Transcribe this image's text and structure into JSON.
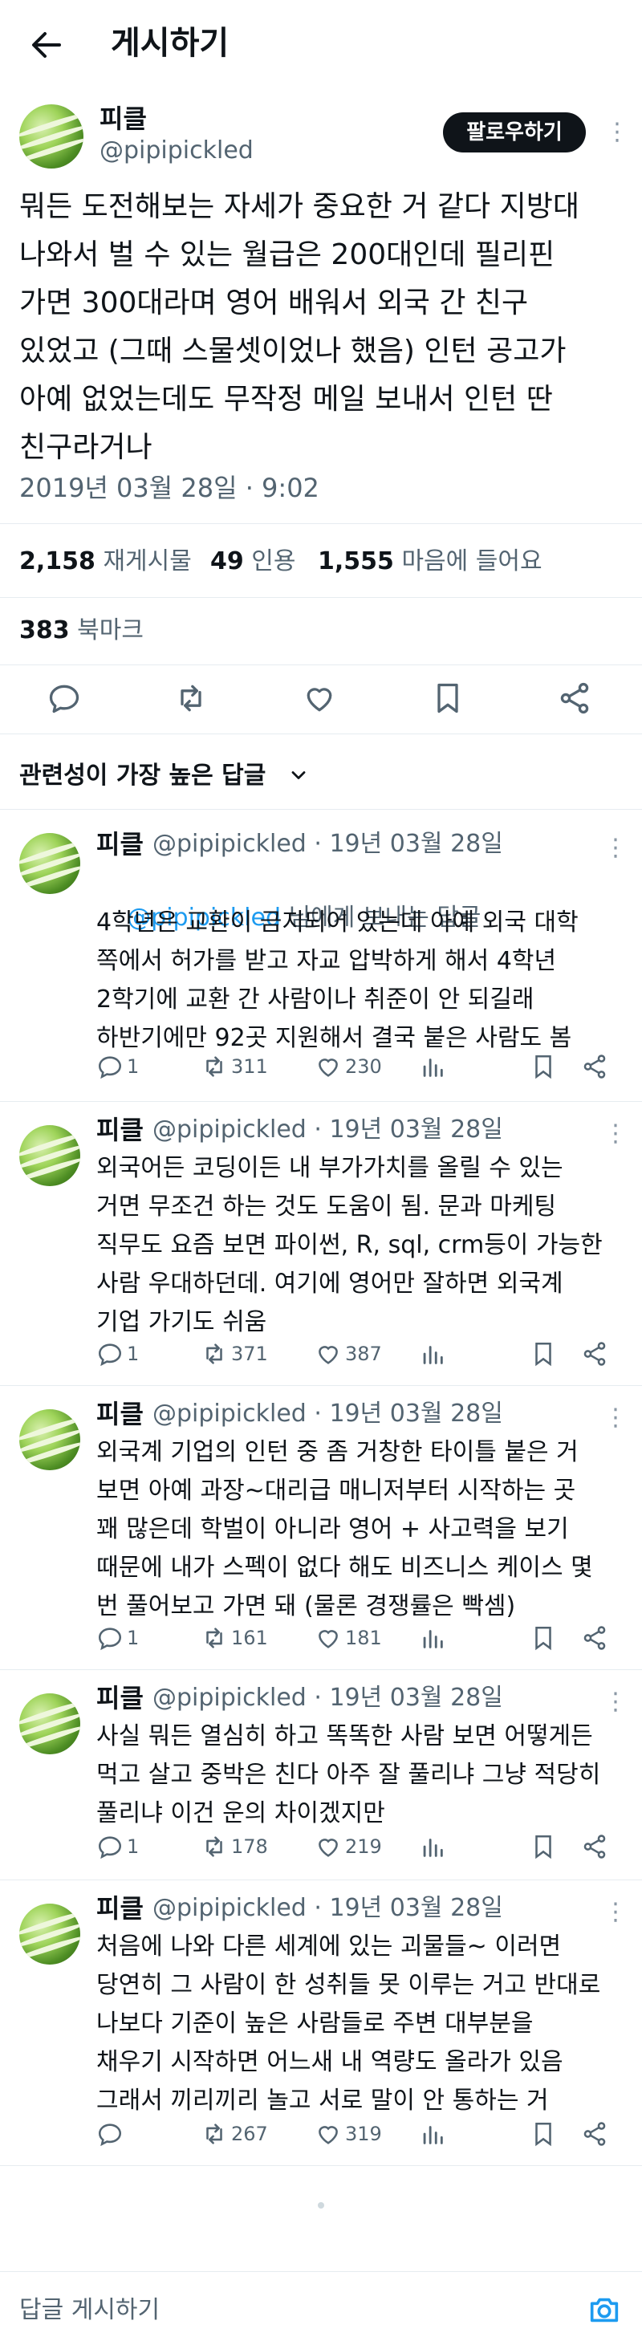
{
  "header": {
    "title": "게시하기"
  },
  "post": {
    "author_name": "피클",
    "author_handle": "@pipipickled",
    "follow_label": "팔로우하기",
    "more_label": "⋮",
    "text": "뭐든 도전해보는 자세가 중요한 거 같다 지방대\n나와서 벌 수 있는 월급은 200대인데 필리핀\n가면 300대라며 영어 배워서 외국 간 친구\n있었고 (그때 스물셋이었나 했음) 인턴 공고가\n아예 없었는데도 무작정 메일 보내서 인턴 딴\n친구라거나",
    "timestamp": "2019년 03월 28일 · 9:02",
    "stats": {
      "reposts_count": "2,158",
      "reposts_label": "재게시물",
      "quotes_count": "49",
      "quotes_label": "인용",
      "likes_count": "1,555",
      "likes_label": "마음에 들어요",
      "bookmarks_count": "383",
      "bookmarks_label": "북마크"
    }
  },
  "sort_label": "관련성이 가장 높은 답글",
  "replies": [
    {
      "name": "피클",
      "handle_line": "@pipipickled · 19년 03월 28일",
      "replying_to_mention": "@pipipickled",
      "replying_to_suffix": " 님에게 보내는 답글",
      "text": "4학년은 교환이 금지되어 있는데 아예 외국 대학\n쪽에서 허가를 받고 자교 압박하게 해서 4학년\n2학기에 교환 간 사람이나 취준이 안 되길래\n하반기에만 92곳 지원해서 결국 붙은 사람도 봄",
      "replies": "1",
      "reposts": "311",
      "likes": "230"
    },
    {
      "name": "피클",
      "handle_line": "@pipipickled · 19년 03월 28일",
      "text": "외국어든 코딩이든 내 부가가치를 올릴 수 있는\n거면 무조건 하는 것도 도움이 됨. 문과 마케팅\n직무도 요즘 보면 파이썬, R, sql, crm등이 가능한\n사람 우대하던데. 여기에 영어만 잘하면 외국계\n기업 가기도 쉬움",
      "replies": "1",
      "reposts": "371",
      "likes": "387"
    },
    {
      "name": "피클",
      "handle_line": "@pipipickled · 19년 03월 28일",
      "text": "외국계 기업의 인턴 중 좀 거창한 타이틀 붙은 거\n보면 아예 과장~대리급 매니저부터 시작하는 곳\n꽤 많은데 학벌이 아니라 영어 + 사고력을 보기\n때문에 내가 스펙이 없다 해도 비즈니스 케이스 몇\n번 풀어보고 가면 돼 (물론 경쟁률은 빡셈)",
      "replies": "1",
      "reposts": "161",
      "likes": "181"
    },
    {
      "name": "피클",
      "handle_line": "@pipipickled · 19년 03월 28일",
      "text": "사실 뭐든 열심히 하고 똑똑한 사람 보면 어떻게든\n먹고 살고 중박은 친다 아주 잘 풀리냐 그냥 적당히\n풀리냐 이건 운의 차이겠지만",
      "replies": "1",
      "reposts": "178",
      "likes": "219"
    },
    {
      "name": "피클",
      "handle_line": "@pipipickled · 19년 03월 28일",
      "text": "처음에 나와 다른 세계에 있는 괴물들~ 이러면\n당연히 그 사람이 한 성취들 못 이루는 거고 반대로\n나보다 기준이 높은 사람들로 주변 대부분을\n채우기 시작하면 어느새 내 역량도 올라가 있음\n그래서 끼리끼리 놀고 서로 말이 안 통하는 거",
      "replies": "",
      "reposts": "267",
      "likes": "319"
    }
  ],
  "composer": {
    "placeholder": "답글 게시하기"
  },
  "colors": {
    "accent": "#1d9bf0",
    "text": "#0f1419",
    "muted": "#536471"
  }
}
